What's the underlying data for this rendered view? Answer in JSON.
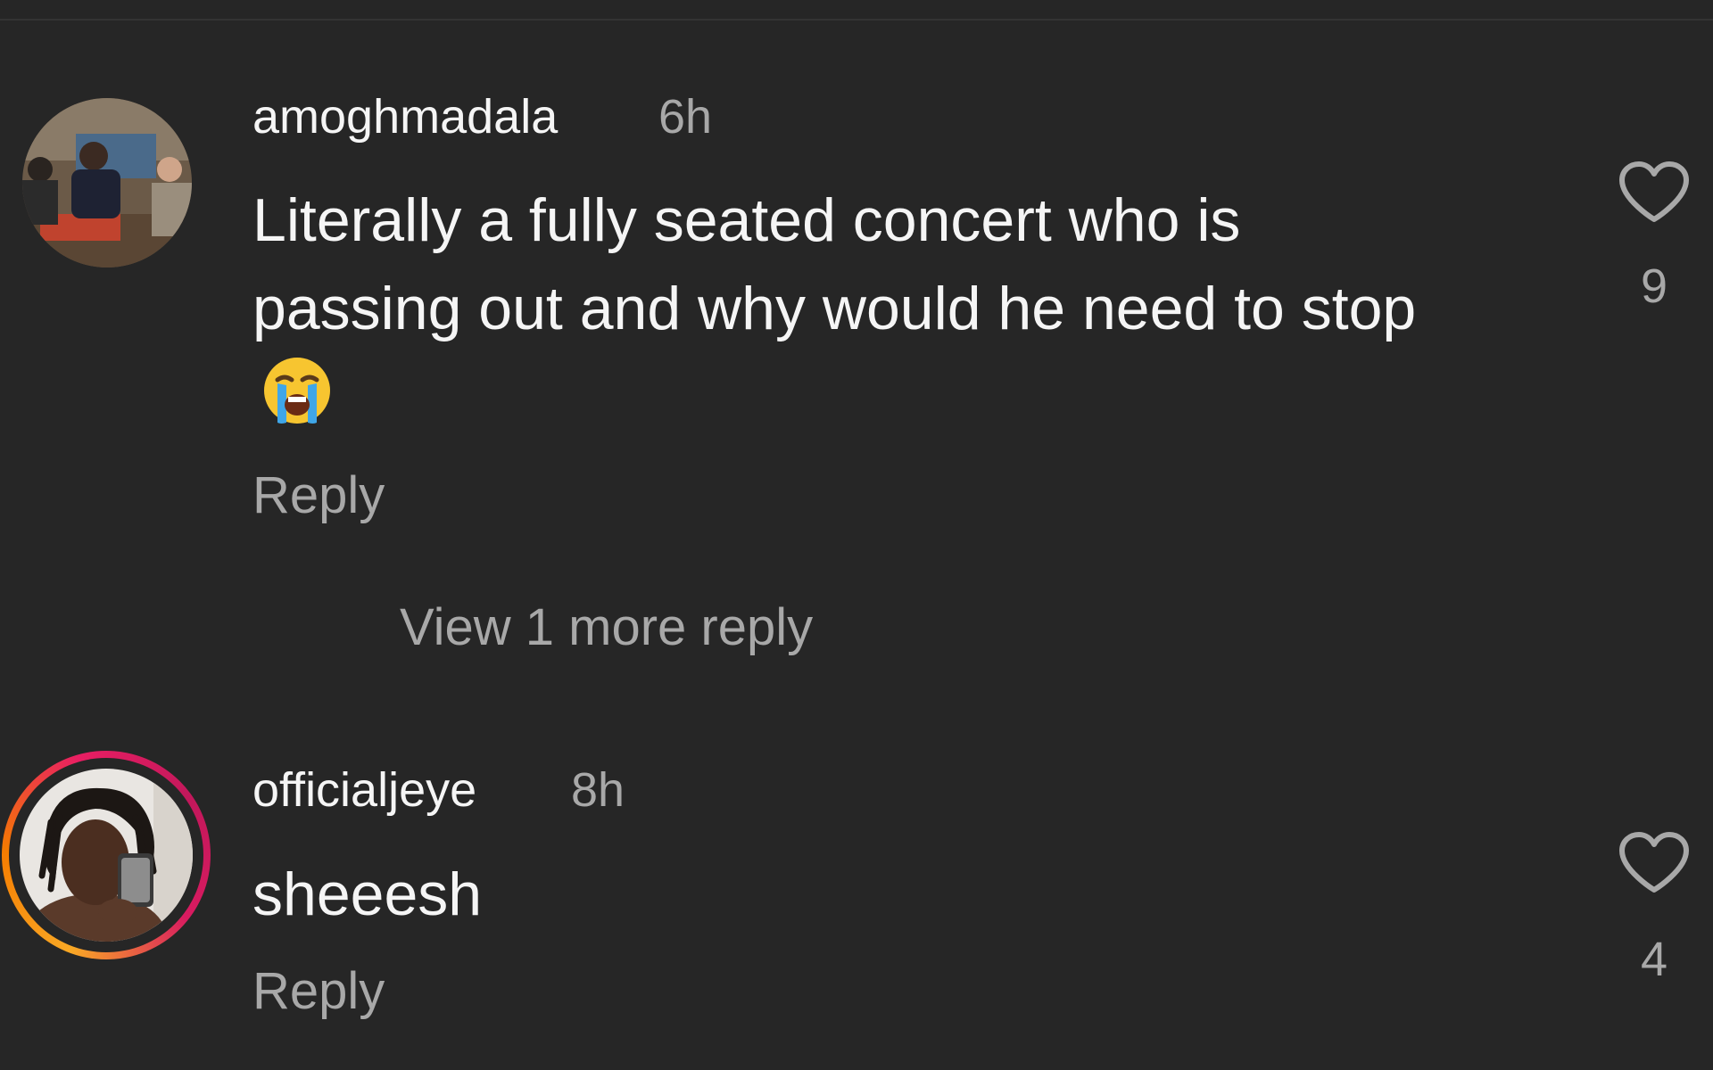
{
  "comments": [
    {
      "username": "amoghmadala",
      "time": "6h",
      "text": "Literally a fully seated concert who is passing out and why would he need to stop",
      "emoji": "loudly-crying-face",
      "reply_label": "Reply",
      "like_count": "9",
      "view_replies_label": "View 1 more reply"
    },
    {
      "username": "officialjeye",
      "time": "8h",
      "text": "sheeesh",
      "reply_label": "Reply",
      "like_count": "4",
      "has_story_ring": true
    }
  ],
  "colors": {
    "background": "#262626",
    "primary_text": "#f5f5f5",
    "secondary_text": "#a8a8a8",
    "story_ring": [
      "#f9a825",
      "#e91e63"
    ]
  }
}
